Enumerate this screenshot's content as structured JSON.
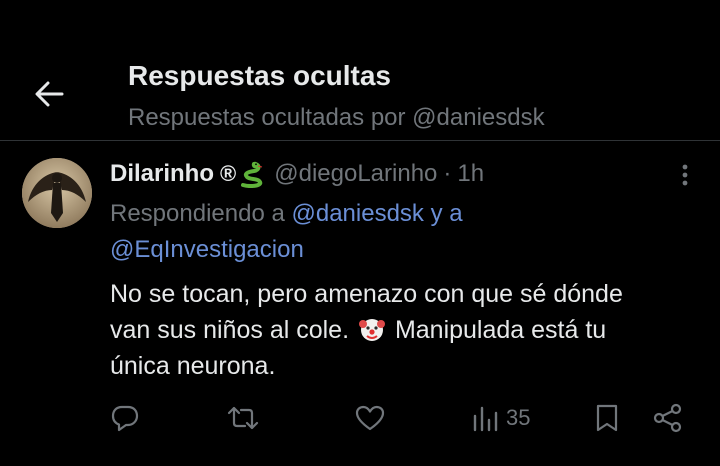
{
  "header": {
    "title": "Respuestas ocultas",
    "subtitle": "Respuestas ocultadas por @daniesdsk",
    "back_icon": "arrow-left-icon"
  },
  "tweet": {
    "author_name": "Dilarinho",
    "badge": "®",
    "name_emoji": "snake-icon",
    "handle": "@diegoLarinho",
    "separator": "·",
    "time": "1h",
    "replying_prefix": "Respondiendo a",
    "replying_mention_1": "@daniesdsk",
    "replying_joiner": "y a",
    "replying_mention_2": "@EqInvestigacion",
    "text_line_1": "No se tocan, pero amenazo con que sé dónde",
    "text_line_2_a": "van sus niños al cole.",
    "text_line_2_emoji": "clown-face-icon",
    "text_line_2_b": "Manipulada está tu",
    "text_line_3": "única neurona.",
    "views": "35"
  },
  "colors": {
    "background": "#000000",
    "primary_text": "#e7e9ea",
    "secondary_text": "#71767b",
    "link": "#6b8fd6",
    "divider": "#2f3336"
  }
}
